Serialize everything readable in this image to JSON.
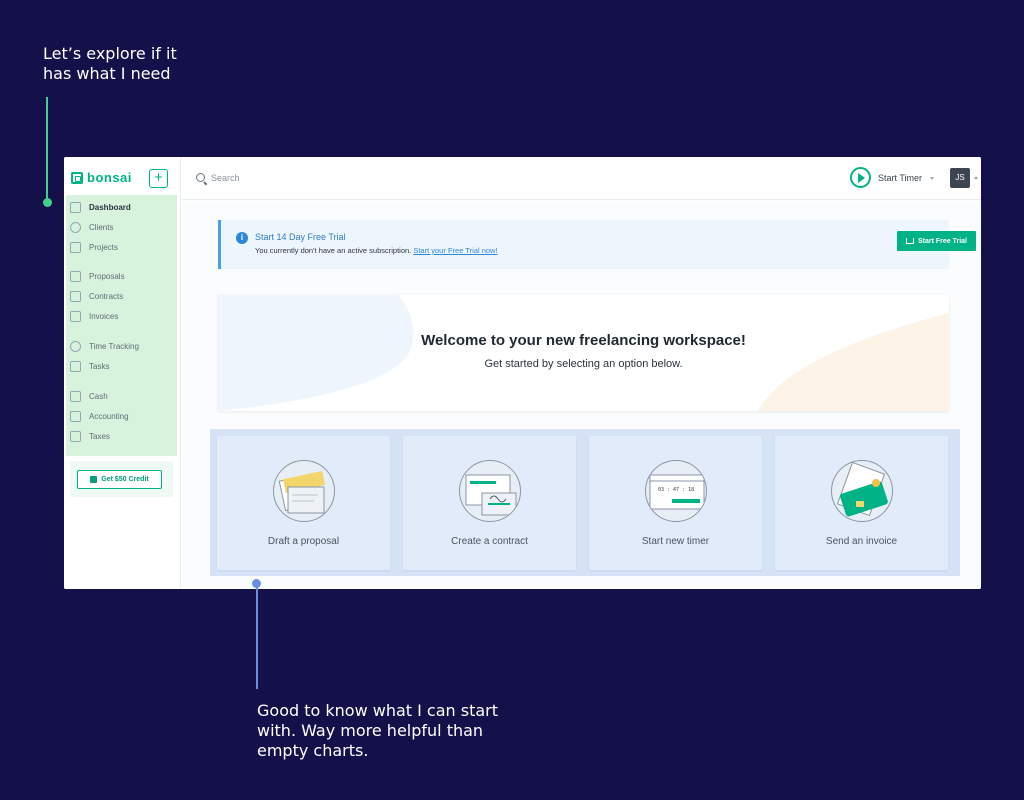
{
  "annotations": {
    "top": "Let’s explore if it\nhas what I need",
    "bottom": "Good to know what I can start\nwith. Way more helpful than\nempty charts."
  },
  "brand": {
    "name": "bonsai",
    "color": "#00b386",
    "add_label": "+"
  },
  "sidebar": {
    "items": [
      {
        "label": "Dashboard",
        "icon": "home-icon",
        "active": true
      },
      {
        "label": "Clients",
        "icon": "clients-icon"
      },
      {
        "label": "Projects",
        "icon": "folder-icon"
      },
      {
        "label": "Proposals",
        "icon": "proposal-icon"
      },
      {
        "label": "Contracts",
        "icon": "contract-icon"
      },
      {
        "label": "Invoices",
        "icon": "invoice-icon"
      },
      {
        "label": "Time Tracking",
        "icon": "clock-icon"
      },
      {
        "label": "Tasks",
        "icon": "tasks-icon"
      },
      {
        "label": "Cash",
        "icon": "cash-icon"
      },
      {
        "label": "Accounting",
        "icon": "accounting-icon"
      },
      {
        "label": "Taxes",
        "icon": "taxes-icon"
      }
    ],
    "credit_label": "Get $50 Credit"
  },
  "topbar": {
    "search_placeholder": "Search",
    "timer_label": "Start Timer",
    "user_initials": "JS"
  },
  "trial": {
    "title": "Start 14 Day Free Trial",
    "text": "You currently don't have an active subscription.",
    "link": "Start your Free Trial now!",
    "button": "Start Free Trial"
  },
  "welcome": {
    "title": "Welcome to your new freelancing workspace!",
    "subtitle": "Get started by selecting an option below."
  },
  "options": [
    {
      "label": "Draft a proposal",
      "icon": "proposal-illustration-icon"
    },
    {
      "label": "Create a contract",
      "icon": "contract-illustration-icon"
    },
    {
      "label": "Start new timer",
      "icon": "timer-illustration-icon",
      "timer_text": "03 : 47 : 18"
    },
    {
      "label": "Send an invoice",
      "icon": "invoice-illustration-icon"
    }
  ]
}
